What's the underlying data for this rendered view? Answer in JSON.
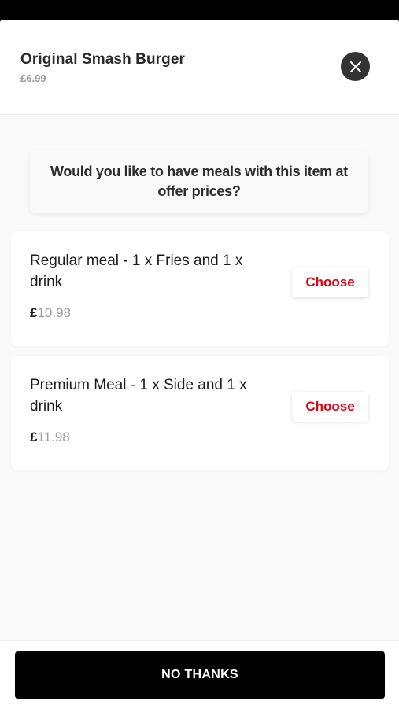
{
  "product": {
    "title": "Original Smash Burger",
    "price": "£6.99",
    "close_icon": "close-icon"
  },
  "offer": {
    "question": "Would you like to have meals with this item at offer prices?"
  },
  "meals": [
    {
      "name": "Regular meal - 1 x Fries and 1 x drink",
      "currency": "£",
      "price": "10.98",
      "action": "Choose"
    },
    {
      "name": "Premium Meal - 1 x Side and 1 x drink",
      "currency": "£",
      "price": "11.98",
      "action": "Choose"
    }
  ],
  "footer": {
    "no_thanks_label": "NO THANKS"
  },
  "colors": {
    "accent": "#e3000f",
    "primary_button": "#000000",
    "close_button": "#333333"
  }
}
